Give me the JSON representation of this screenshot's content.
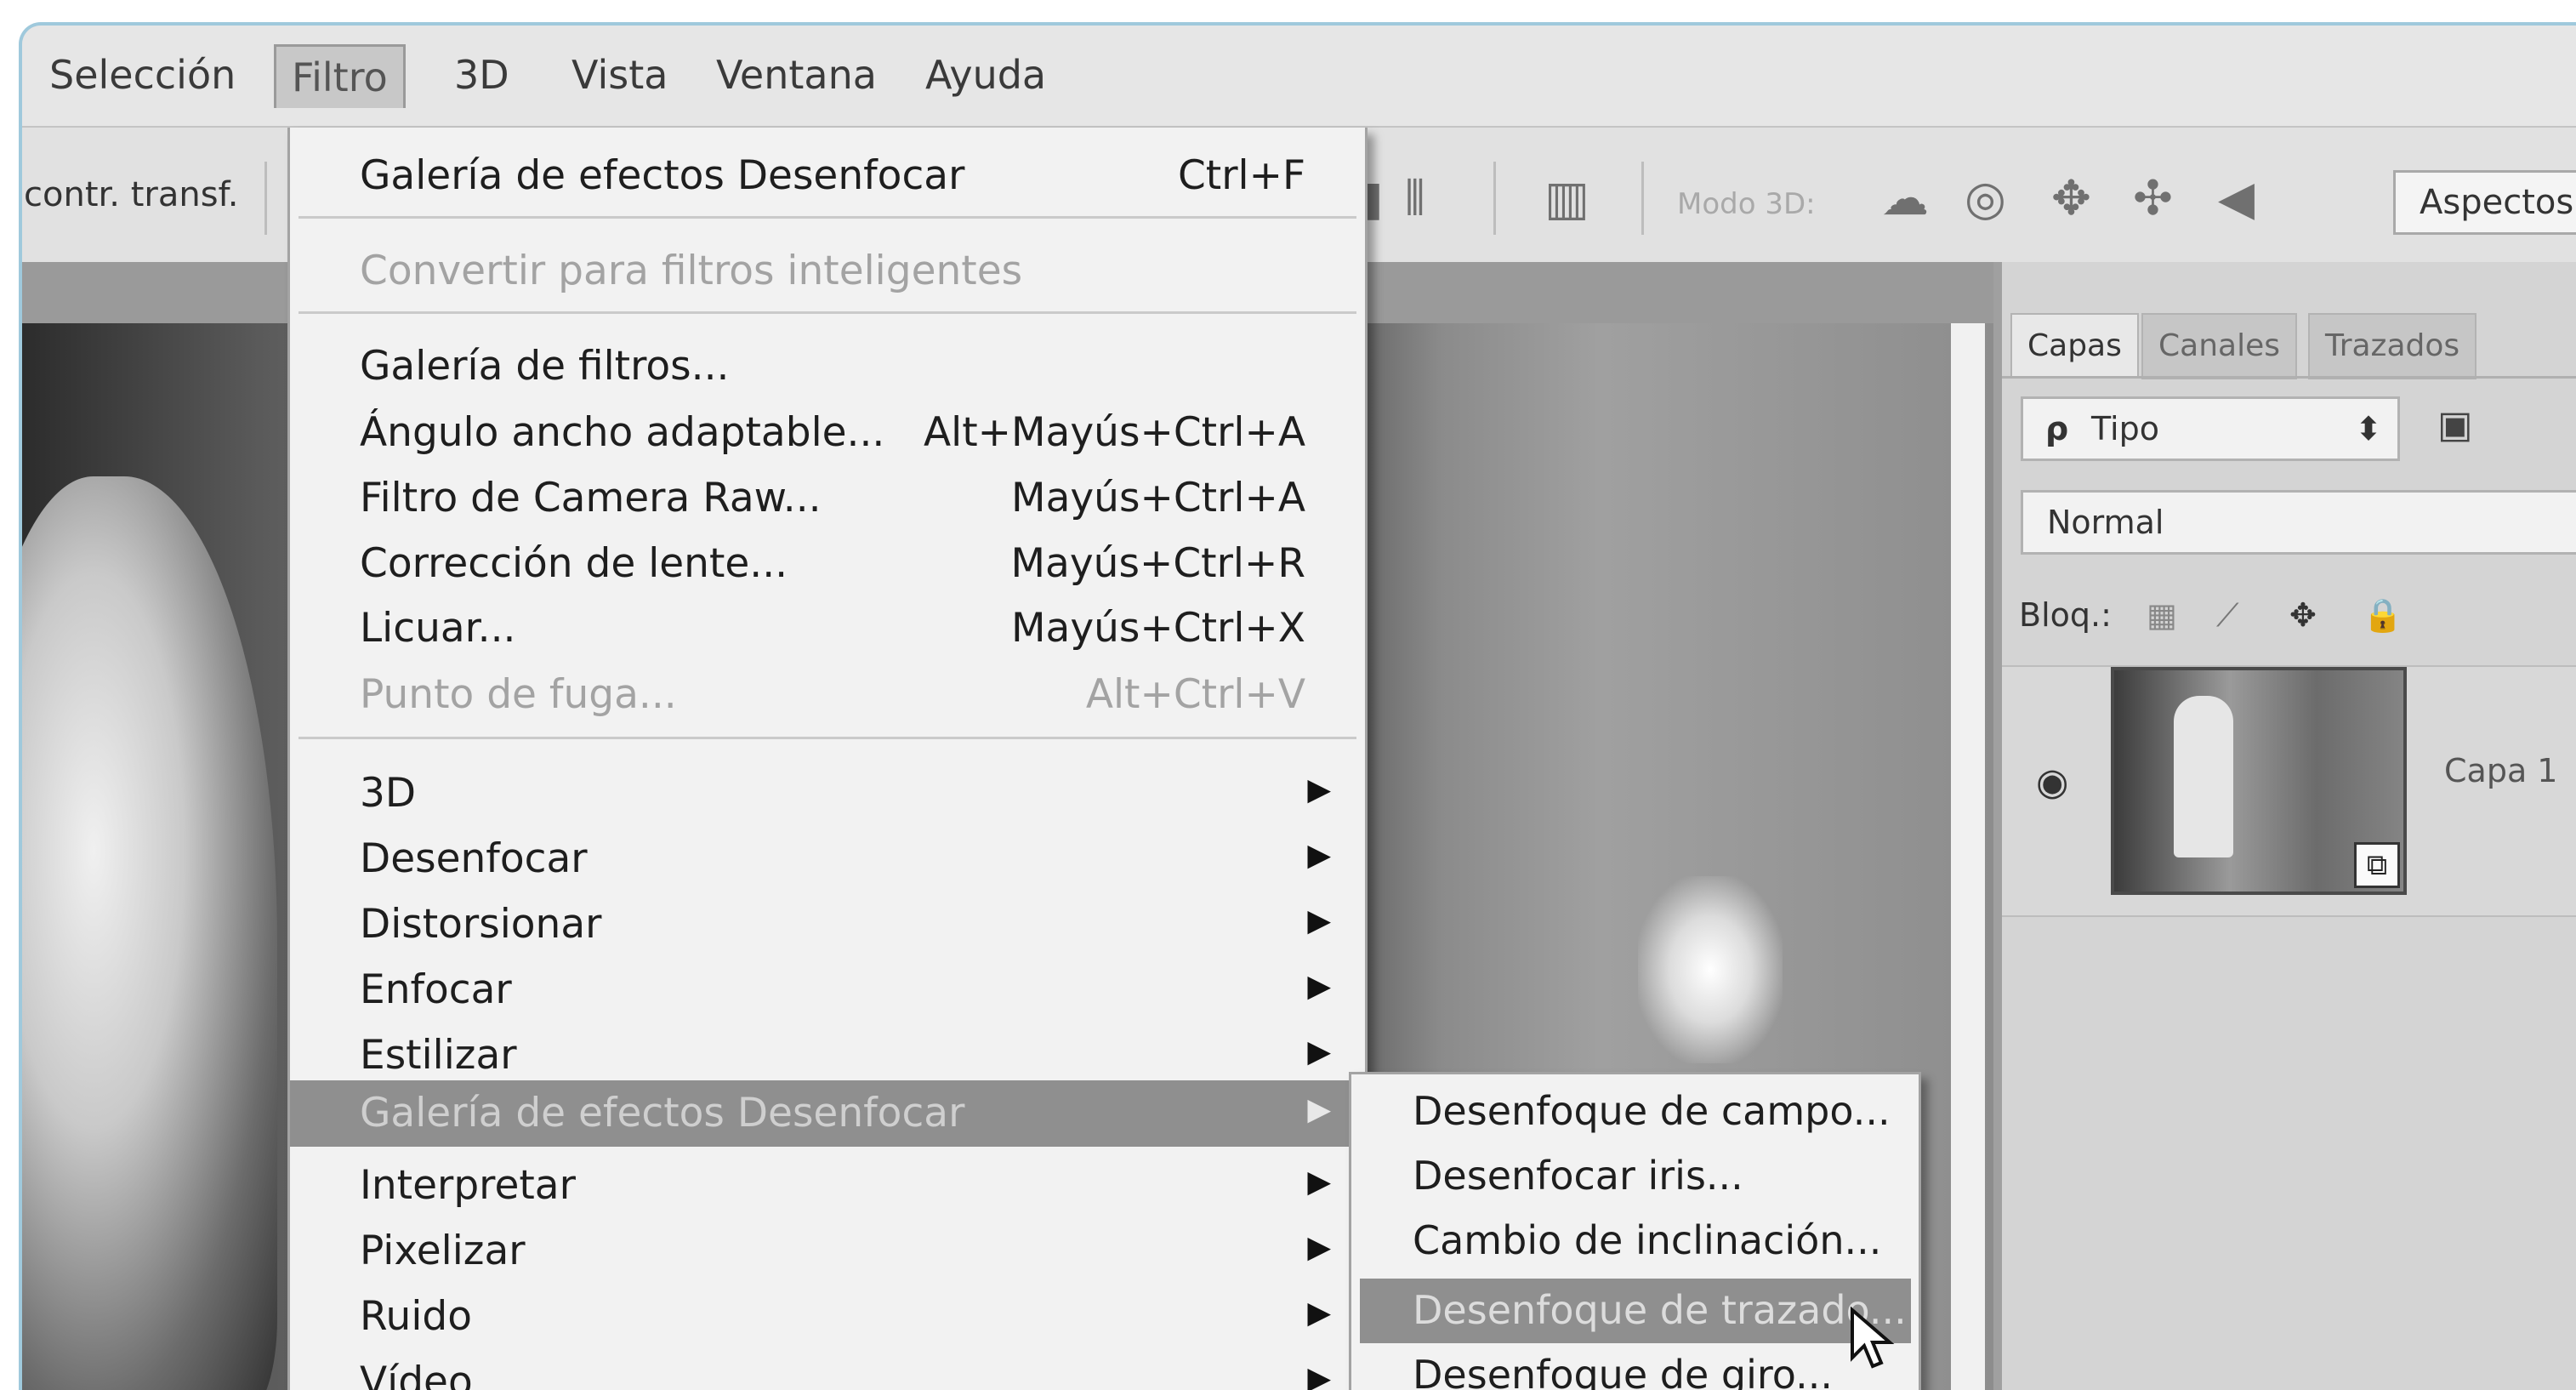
{
  "menubar": {
    "items": [
      "Selección",
      "Filtro",
      "3D",
      "Vista",
      "Ventana",
      "Ayuda"
    ],
    "active": "Filtro"
  },
  "optionsbar": {
    "transform_label": "contr. transf.",
    "mode3d_label": "Modo 3D:",
    "workspace": "Aspectos e"
  },
  "filter_menu": {
    "items": [
      {
        "label": "Galería de efectos Desenfocar",
        "shortcut": "Ctrl+F"
      },
      {
        "label": "Convertir para filtros inteligentes",
        "disabled": true
      },
      {
        "label": "Galería de filtros..."
      },
      {
        "label": "Ángulo ancho adaptable...",
        "shortcut": "Alt+Mayús+Ctrl+A"
      },
      {
        "label": "Filtro de Camera Raw...",
        "shortcut": "Mayús+Ctrl+A"
      },
      {
        "label": "Corrección de lente...",
        "shortcut": "Mayús+Ctrl+R"
      },
      {
        "label": "Licuar...",
        "shortcut": "Mayús+Ctrl+X"
      },
      {
        "label": "Punto de fuga...",
        "shortcut": "Alt+Ctrl+V",
        "disabled": true
      },
      {
        "label": "3D",
        "submenu": true
      },
      {
        "label": "Desenfocar",
        "submenu": true
      },
      {
        "label": "Distorsionar",
        "submenu": true
      },
      {
        "label": "Enfocar",
        "submenu": true
      },
      {
        "label": "Estilizar",
        "submenu": true
      },
      {
        "label": "Galería de efectos Desenfocar",
        "submenu": true,
        "highlighted": true
      },
      {
        "label": "Interpretar",
        "submenu": true
      },
      {
        "label": "Pixelizar",
        "submenu": true
      },
      {
        "label": "Ruido",
        "submenu": true
      },
      {
        "label": "Vídeo",
        "submenu": true
      }
    ]
  },
  "blur_gallery_submenu": {
    "items": [
      {
        "label": "Desenfoque de campo..."
      },
      {
        "label": "Desenfocar iris..."
      },
      {
        "label": "Cambio de inclinación..."
      },
      {
        "label": "Desenfoque de trazado...",
        "highlighted": true
      },
      {
        "label": "Desenfoque de giro..."
      }
    ]
  },
  "layers_panel": {
    "tabs": [
      "Capas",
      "Canales",
      "Trazados"
    ],
    "active_tab": "Capas",
    "filter_kind": "Tipo",
    "blend_mode": "Normal",
    "lock_label": "Bloq.:",
    "layer_name": "Capa 1"
  },
  "icons": {
    "submenu_arrow": "▶",
    "select_arrows": "⬍",
    "eye": "visibility-eye-icon",
    "lock": "lock-icon"
  },
  "colors": {
    "menu_bg": "#f2f2f2",
    "highlight": "#8f8f8f",
    "disabled_text": "#a3a3a3",
    "window_border": "#9fc9dc"
  }
}
